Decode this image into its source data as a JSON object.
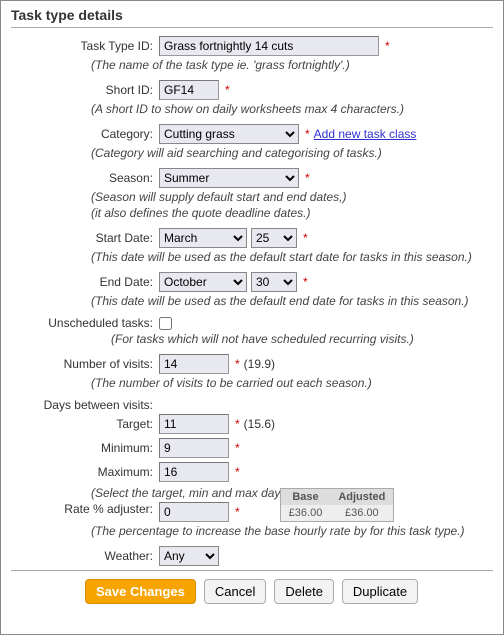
{
  "title": "Task type details",
  "fields": {
    "taskTypeId": {
      "label": "Task Type ID:",
      "value": "Grass fortnightly 14 cuts",
      "hint": "(The name of the task type ie. 'grass fortnightly'.)"
    },
    "shortId": {
      "label": "Short ID:",
      "value": "GF14",
      "hint": "(A short ID to show on daily worksheets max 4 characters.)"
    },
    "category": {
      "label": "Category:",
      "value": "Cutting grass",
      "link": "Add new task class",
      "hint": "(Category will aid searching and categorising of tasks.)"
    },
    "season": {
      "label": "Season:",
      "value": "Summer",
      "hint1": "(Season will supply default start and end dates,)",
      "hint2": "(it also defines the quote deadline dates.)"
    },
    "startDate": {
      "label": "Start Date:",
      "month": "March",
      "day": "25",
      "hint": "(This date will be used as the default start date for tasks in this season.)"
    },
    "endDate": {
      "label": "End Date:",
      "month": "October",
      "day": "30",
      "hint": "(This date will be used as the default end date for tasks in this season.)"
    },
    "unscheduled": {
      "label": "Unscheduled tasks:",
      "checked": false,
      "hint": "(For tasks which will not have scheduled recurring visits.)"
    },
    "visits": {
      "label": "Number of visits:",
      "value": "14",
      "calc": "(19.9)",
      "hint": "(The number of visits to be carried out each season.)"
    },
    "daysBetween": {
      "label": "Days between visits:",
      "target": {
        "label": "Target:",
        "value": "11",
        "calc": "(15.6)"
      },
      "minimum": {
        "label": "Minimum:",
        "value": "9"
      },
      "maximum": {
        "label": "Maximum:",
        "value": "16"
      },
      "hint": "(Select the target, min and max days between visits.)"
    },
    "rate": {
      "label": "Rate % adjuster:",
      "value": "0",
      "table": {
        "baseHeader": "Base",
        "adjHeader": "Adjusted",
        "base": "£36.00",
        "adjusted": "£36.00"
      },
      "hint": "(The percentage to increase the base hourly rate by for this task type.)"
    },
    "weather": {
      "label": "Weather:",
      "value": "Any"
    }
  },
  "asterisk": "*",
  "actions": {
    "save": "Save Changes",
    "cancel": "Cancel",
    "delete": "Delete",
    "duplicate": "Duplicate"
  }
}
